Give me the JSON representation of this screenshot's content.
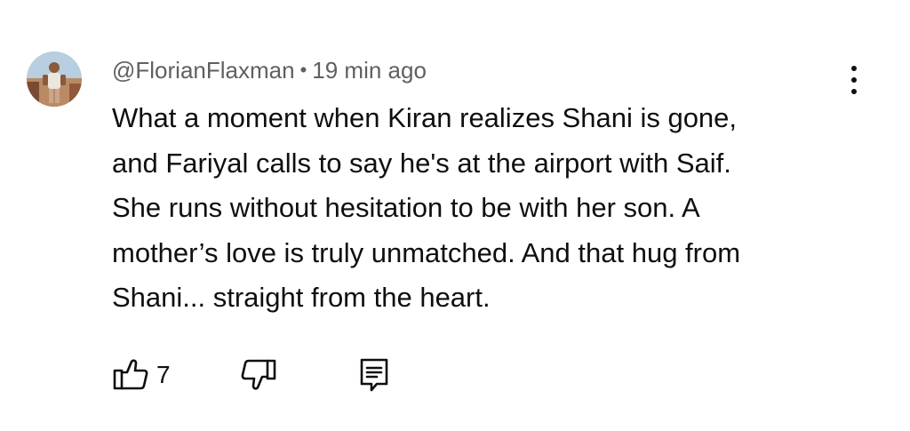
{
  "comment": {
    "author": "@FlorianFlaxman",
    "separator": "•",
    "timestamp": "19 min ago",
    "text_lines": [
      "What a moment when Kiran realizes Shani is gone,",
      "and Fariyal calls to say he's at the airport with Saif.",
      "She runs without hesitation to be with her son. A",
      "mother’s love is truly unmatched. And that hug from",
      "Shani... straight from the heart."
    ],
    "like_count": "7"
  },
  "icons": {
    "avatar": "user-avatar",
    "menu": "more-vert-icon",
    "like": "thumbs-up-icon",
    "dislike": "thumbs-down-icon",
    "reply": "reply-comment-icon"
  },
  "colors": {
    "text_primary": "#0f0f0f",
    "text_secondary": "#606060",
    "background": "#ffffff"
  }
}
